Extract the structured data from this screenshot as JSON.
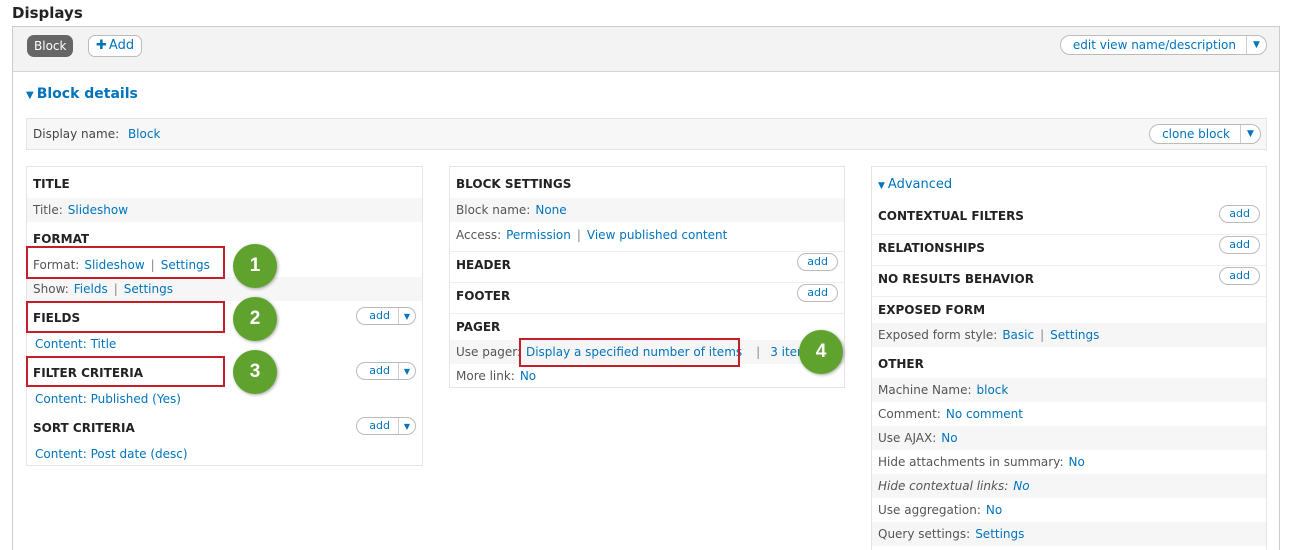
{
  "page": {
    "title": "Displays"
  },
  "topbar": {
    "tab_label": "Block",
    "add_label": "Add",
    "edit_view_label": "edit view name/description"
  },
  "block_details": {
    "heading": "Block details",
    "display_name_label": "Display name:",
    "display_name_value": "Block",
    "clone_label": "clone block"
  },
  "left": {
    "title_heading": "TITLE",
    "title_label": "Title:",
    "title_value": "Slideshow",
    "format_heading": "FORMAT",
    "format_label": "Format:",
    "format_value": "Slideshow",
    "format_settings": "Settings",
    "show_label": "Show:",
    "show_value": "Fields",
    "show_settings": "Settings",
    "fields_heading": "FIELDS",
    "fields_add": "add",
    "fields_item": "Content: Title",
    "filter_heading": "FILTER CRITERIA",
    "filter_add": "add",
    "filter_item": "Content: Published (Yes)",
    "sort_heading": "SORT CRITERIA",
    "sort_add": "add",
    "sort_item": "Content: Post date (desc)"
  },
  "middle": {
    "block_settings_heading": "BLOCK SETTINGS",
    "block_name_label": "Block name:",
    "block_name_value": "None",
    "access_label": "Access:",
    "access_value": "Permission",
    "access_perm": "View published content",
    "header_heading": "HEADER",
    "header_add": "add",
    "footer_heading": "FOOTER",
    "footer_add": "add",
    "pager_heading": "PAGER",
    "use_pager_label": "Use pager:",
    "use_pager_value": "Display a specified number of items",
    "items_value": "3 items",
    "more_link_label": "More link:",
    "more_link_value": "No"
  },
  "right": {
    "advanced_heading": "Advanced",
    "contextual_heading": "CONTEXTUAL FILTERS",
    "contextual_add": "add",
    "relationships_heading": "RELATIONSHIPS",
    "relationships_add": "add",
    "no_results_heading": "NO RESULTS BEHAVIOR",
    "no_results_add": "add",
    "exposed_heading": "EXPOSED FORM",
    "exposed_label": "Exposed form style:",
    "exposed_value": "Basic",
    "exposed_settings": "Settings",
    "other_heading": "OTHER",
    "machine_label": "Machine Name:",
    "machine_value": "block",
    "comment_label": "Comment:",
    "comment_value": "No comment",
    "ajax_label": "Use AJAX:",
    "ajax_value": "No",
    "hide_attach_label": "Hide attachments in summary:",
    "hide_attach_value": "No",
    "hide_ctx_label": "Hide contextual links:",
    "hide_ctx_value": "No",
    "aggregation_label": "Use aggregation:",
    "aggregation_value": "No",
    "query_label": "Query settings:",
    "query_value": "Settings"
  },
  "annotations": {
    "one": "1",
    "two": "2",
    "three": "3",
    "four": "4"
  },
  "colors": {
    "link": "#0074bd",
    "highlight": "#c41e2b",
    "badge": "#5fa22e"
  }
}
